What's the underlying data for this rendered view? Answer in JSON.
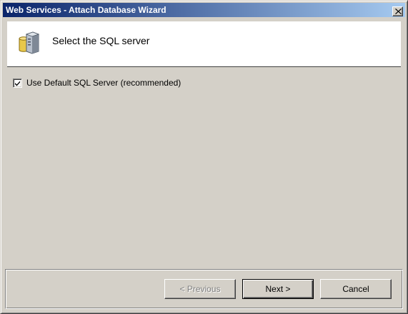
{
  "window": {
    "title": "Web Services - Attach Database Wizard",
    "close_icon": "close-icon"
  },
  "header": {
    "icon": "database-server-icon",
    "title": "Select the SQL server"
  },
  "options": {
    "use_default": {
      "label": "Use Default SQL Server (recommended)",
      "checked": true
    }
  },
  "buttons": {
    "previous": {
      "label": "< Previous",
      "enabled": false
    },
    "next": {
      "label": "Next >",
      "enabled": true,
      "default": true
    },
    "cancel": {
      "label": "Cancel",
      "enabled": true
    }
  },
  "colors": {
    "titlebar_start": "#0a246a",
    "titlebar_end": "#a6caf0",
    "dialog_face": "#d4d0c8"
  }
}
